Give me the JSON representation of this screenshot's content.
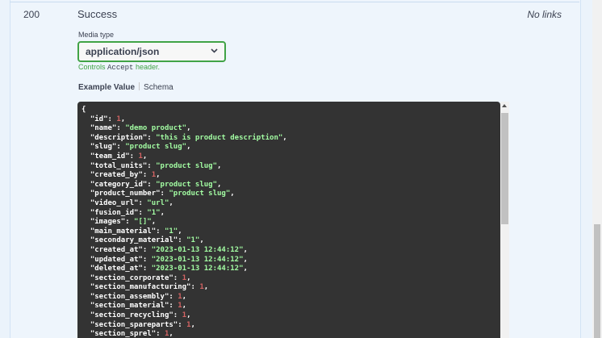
{
  "response": {
    "code": "200",
    "description": "Success",
    "links": "No links"
  },
  "media_type": {
    "label": "Media type",
    "selected": "application/json",
    "controls_prefix": "Controls",
    "controls_code": "Accept",
    "controls_suffix": "header."
  },
  "tabs": {
    "example": "Example Value",
    "schema": "Schema"
  },
  "example_json": {
    "open": "{",
    "entries": [
      {
        "key": "id",
        "value": "1",
        "type": "number"
      },
      {
        "key": "name",
        "value": "demo product",
        "type": "string"
      },
      {
        "key": "description",
        "value": "this is product description",
        "type": "string"
      },
      {
        "key": "slug",
        "value": "product slug",
        "type": "string"
      },
      {
        "key": "team_id",
        "value": "1",
        "type": "number"
      },
      {
        "key": "total_units",
        "value": "product slug",
        "type": "string"
      },
      {
        "key": "created_by",
        "value": "1",
        "type": "number"
      },
      {
        "key": "category_id",
        "value": "product slug",
        "type": "string"
      },
      {
        "key": "product_number",
        "value": "product slug",
        "type": "string"
      },
      {
        "key": "video_url",
        "value": "url",
        "type": "string"
      },
      {
        "key": "fusion_id",
        "value": "1",
        "type": "string"
      },
      {
        "key": "images",
        "value": "[]",
        "type": "string"
      },
      {
        "key": "main_material",
        "value": "1",
        "type": "string"
      },
      {
        "key": "secondary_material",
        "value": "1",
        "type": "string"
      },
      {
        "key": "created_at",
        "value": "2023-01-13 12:44:12",
        "type": "string"
      },
      {
        "key": "updated_at",
        "value": "2023-01-13 12:44:12",
        "type": "string"
      },
      {
        "key": "deleted_at",
        "value": "2023-01-13 12:44:12",
        "type": "string"
      },
      {
        "key": "section_corporate",
        "value": "1",
        "type": "number"
      },
      {
        "key": "section_manufacturing",
        "value": "1",
        "type": "number"
      },
      {
        "key": "section_assembly",
        "value": "1",
        "type": "number"
      },
      {
        "key": "section_material",
        "value": "1",
        "type": "number"
      },
      {
        "key": "section_recycling",
        "value": "1",
        "type": "number"
      },
      {
        "key": "section_spareparts",
        "value": "1",
        "type": "number"
      },
      {
        "key": "section_sprel",
        "value": "1",
        "type": "number"
      }
    ]
  },
  "colors": {
    "accent_green": "#41a346",
    "code_bg": "#333333",
    "string_color": "#a2fca2",
    "number_color": "#d36363"
  }
}
